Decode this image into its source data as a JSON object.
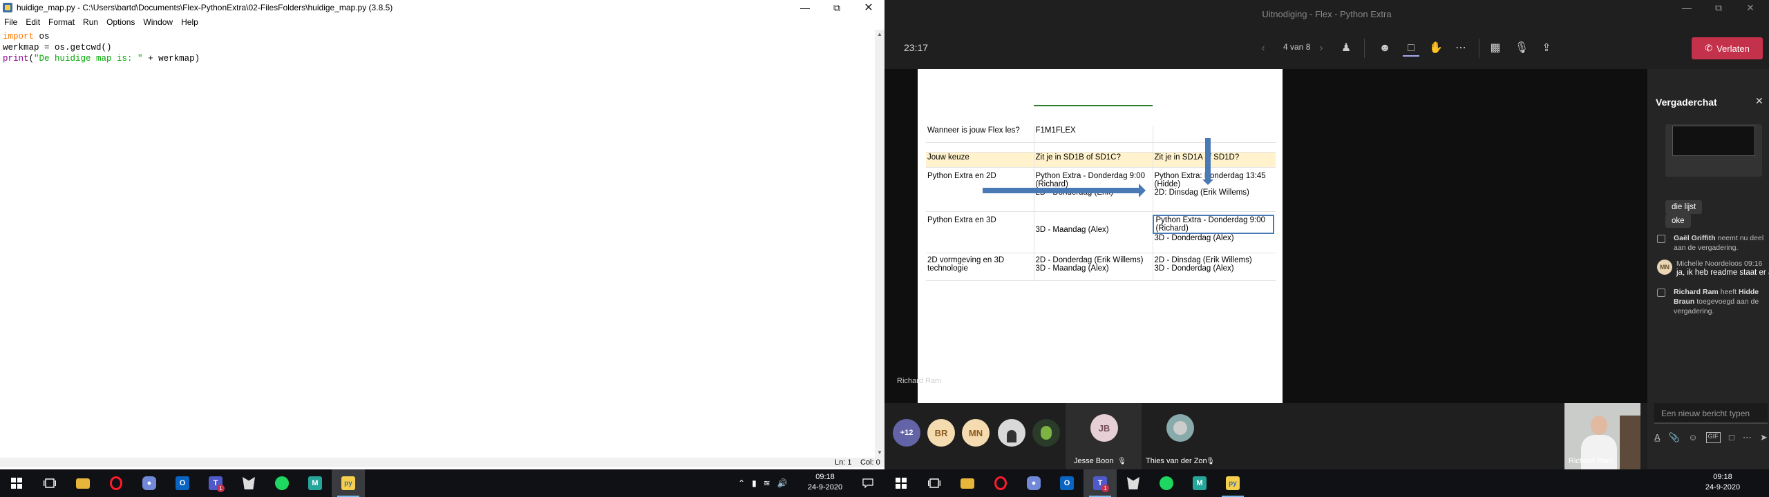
{
  "idle": {
    "title": "huidige_map.py - C:\\Users\\bartd\\Documents\\Flex-PythonExtra\\02-FilesFolders\\huidige_map.py (3.8.5)",
    "menu": [
      "File",
      "Edit",
      "Format",
      "Run",
      "Options",
      "Window",
      "Help"
    ],
    "code": {
      "l1_kw": "import",
      "l1_rest": " os",
      "l2": "werkmap = os.getcwd()",
      "l3_fn": "print",
      "l3_a": "(",
      "l3_str": "\"De huidige map is: \"",
      "l3_rest": " + werkmap)"
    },
    "status_ln": "Ln: 1",
    "status_col": "Col: 0"
  },
  "taskbar": {
    "left_time": "09:18",
    "left_date": "24-9-2020",
    "right_time": "09:18",
    "right_date": "24-9-2020",
    "teams_badge": "1"
  },
  "teams": {
    "window_title": "Uitnodiging - Flex - Python Extra",
    "timer": "23:17",
    "page": "4 van 8",
    "leave": "Verlaten",
    "presenter": "Richard Ram",
    "slide": {
      "r1": [
        "Wanneer is jouw Flex les?",
        "F1M1FLEX",
        ""
      ],
      "r2": [
        "Jouw keuze",
        "Zit je in SD1B of SD1C?",
        "Zit je in SD1A of SD1D?"
      ],
      "r3": [
        "Python Extra en 2D",
        "Python Extra - Donderdag 9:00 (Richard)",
        "2D - Donderdag (Erik)",
        "Python Extra: Donderdag 13:45 (Hidde)",
        "2D: Dinsdag (Erik Willems)"
      ],
      "r4": [
        "Python Extra en 3D",
        "",
        "3D - Maandag (Alex)",
        "Python Extra - Donderdag 9:00 (Richard)",
        "3D - Donderdag (Alex)"
      ],
      "r5": [
        "2D vormgeving en 3D technologie",
        "2D - Donderdag (Erik Willems)",
        "3D - Maandag (Alex)",
        "2D - Dinsdag (Erik Willems)",
        "3D - Donderdag (Alex)"
      ]
    },
    "roster": {
      "more": "+12",
      "br": "BR",
      "mn": "MN",
      "jb": "JB",
      "jesse": "Jesse Boon",
      "thies": "Thies van der Zon",
      "richard": "Richard Ram"
    },
    "chat": {
      "title": "Vergaderchat",
      "b1": "die lijst",
      "b2": "oke",
      "sys1_name": "Gaël Griffith",
      "sys1_rest": " neemt nu deel aan de vergadering.",
      "msg_avatar": "MN",
      "msg_who": "Michelle Noordeloos   09:16",
      "msg_text": "ja, ik heb readme staat er al op",
      "sys2_name": "Richard Ram",
      "sys2_mid": " heeft ",
      "sys2_name2": "Hidde Braun",
      "sys2_rest": " toegevoegd aan de vergadering.",
      "placeholder": "Een nieuw bericht typen"
    }
  },
  "colors": {
    "leave": "#c4314b",
    "arrow": "#4a7ab5",
    "highlight_row": "#fff2cc",
    "taskbar": "#101114",
    "teams_bg": "#1f1f1f"
  }
}
